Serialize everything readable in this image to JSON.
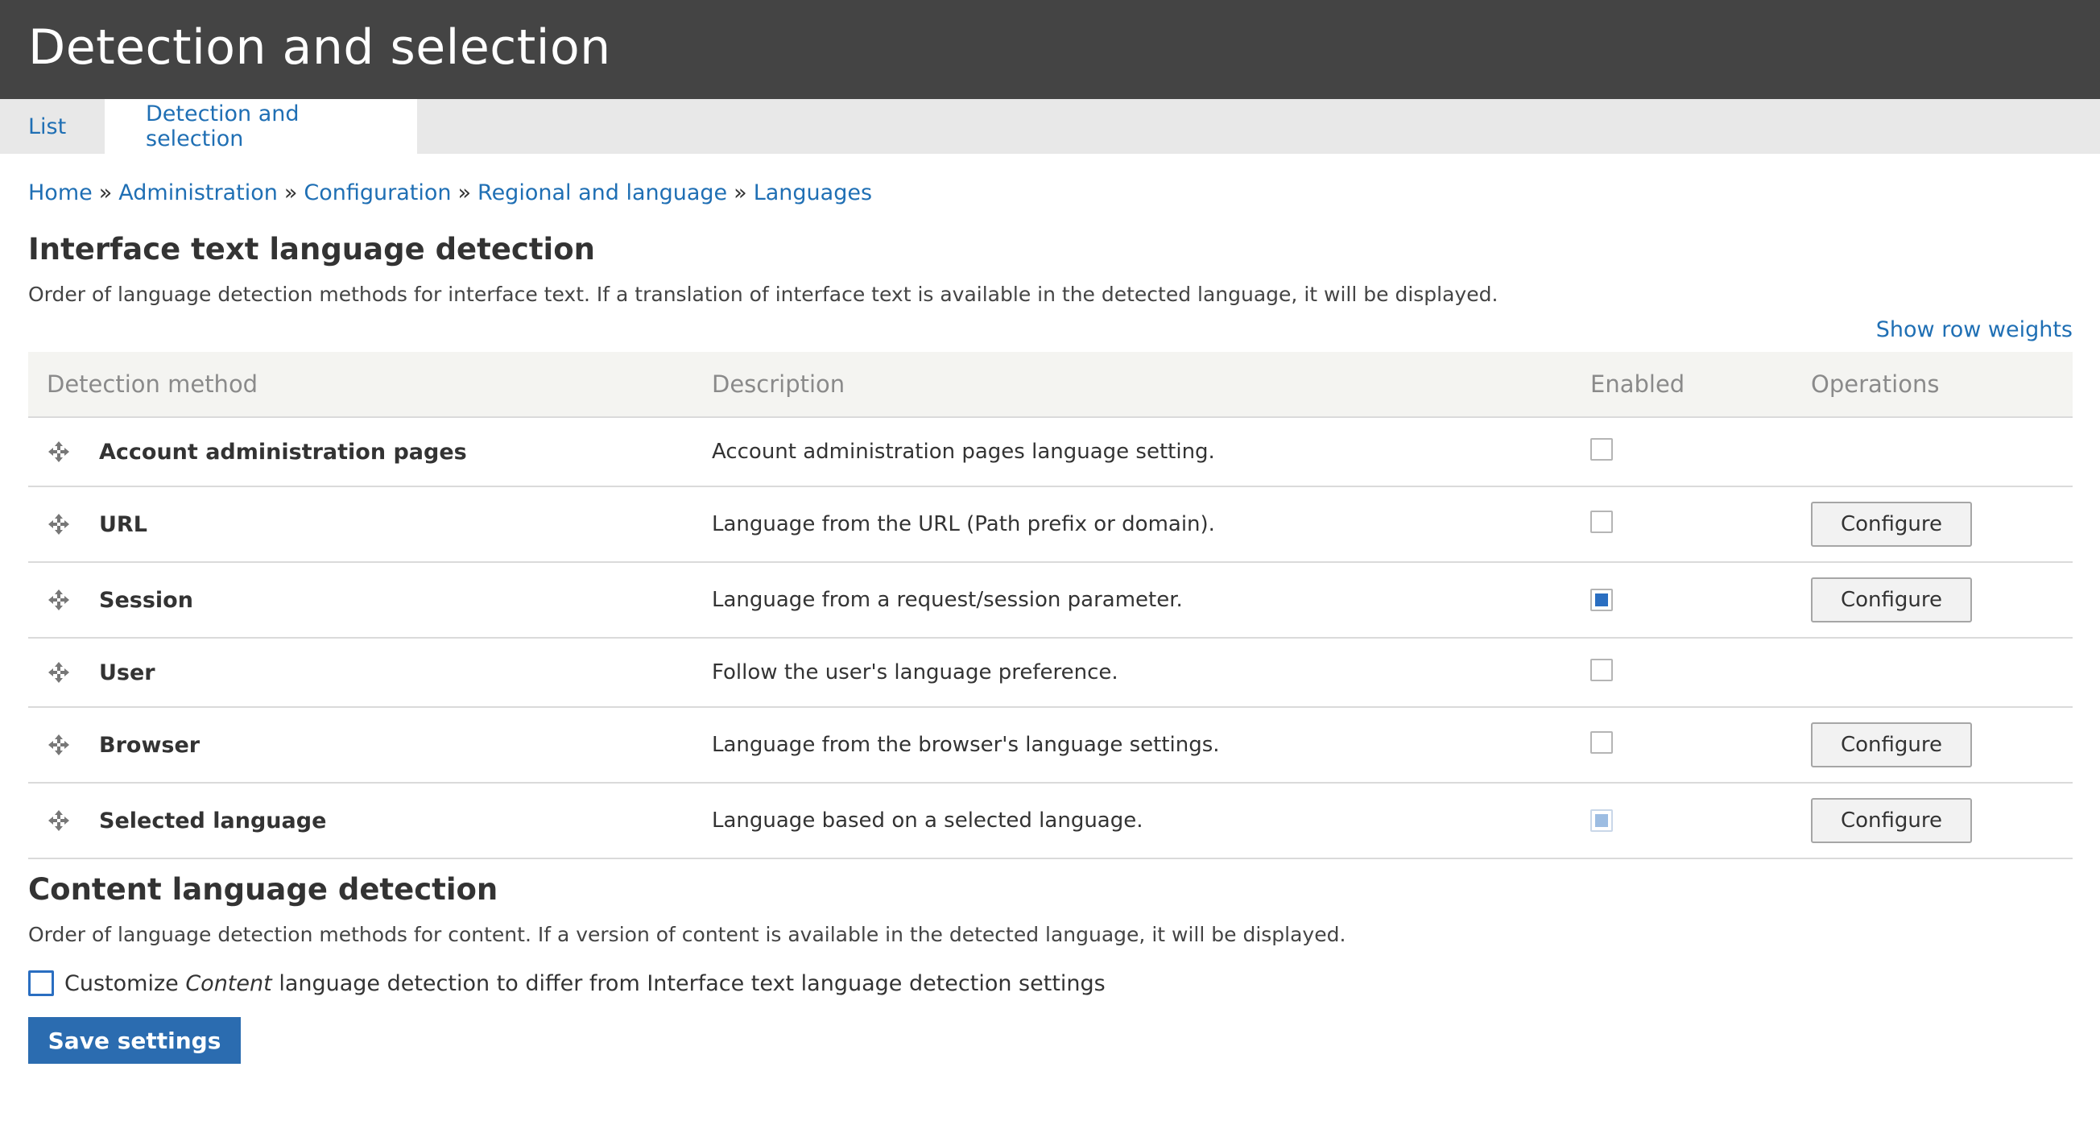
{
  "header": {
    "title": "Detection and selection"
  },
  "tabs": [
    {
      "label": "List"
    },
    {
      "label": "Detection and selection"
    }
  ],
  "breadcrumb": {
    "separator": "»",
    "items": [
      {
        "label": "Home"
      },
      {
        "label": "Administration"
      },
      {
        "label": "Configuration"
      },
      {
        "label": "Regional and language"
      },
      {
        "label": "Languages"
      }
    ]
  },
  "interface_section": {
    "title": "Interface text language detection",
    "description": "Order of language detection methods for interface text. If a translation of interface text is available in the detected language, it will be displayed.",
    "show_row_weights": "Show row weights",
    "columns": {
      "method": "Detection method",
      "description": "Description",
      "enabled": "Enabled",
      "operations": "Operations"
    },
    "rows": [
      {
        "name": "Account administration pages",
        "description": "Account administration pages language setting.",
        "enabled": false,
        "operation": ""
      },
      {
        "name": "URL",
        "description": "Language from the URL (Path prefix or domain).",
        "enabled": false,
        "operation": "Configure"
      },
      {
        "name": "Session",
        "description": "Language from a request/session parameter.",
        "enabled": true,
        "operation": "Configure"
      },
      {
        "name": "User",
        "description": "Follow the user's language preference.",
        "enabled": false,
        "operation": ""
      },
      {
        "name": "Browser",
        "description": "Language from the browser's language settings.",
        "enabled": false,
        "operation": "Configure"
      },
      {
        "name": "Selected language",
        "description": "Language based on a selected language.",
        "enabled": true,
        "enabled_disabled": true,
        "operation": "Configure"
      }
    ]
  },
  "content_section": {
    "title": "Content language detection",
    "description": "Order of language detection methods for content. If a version of content is available in the detected language, it will be displayed.",
    "customize_prefix": "Customize",
    "customize_em": "Content",
    "customize_suffix": "language detection to differ from Interface text language detection settings",
    "customize_checked": false
  },
  "save_label": "Save settings",
  "colors": {
    "header_bg": "#444444",
    "link": "#1f6fb4",
    "primary_button": "#2b6cb0",
    "checkbox_checked": "#2a6ec1"
  },
  "icons": {
    "drag_handle": "drag-handle-icon"
  }
}
